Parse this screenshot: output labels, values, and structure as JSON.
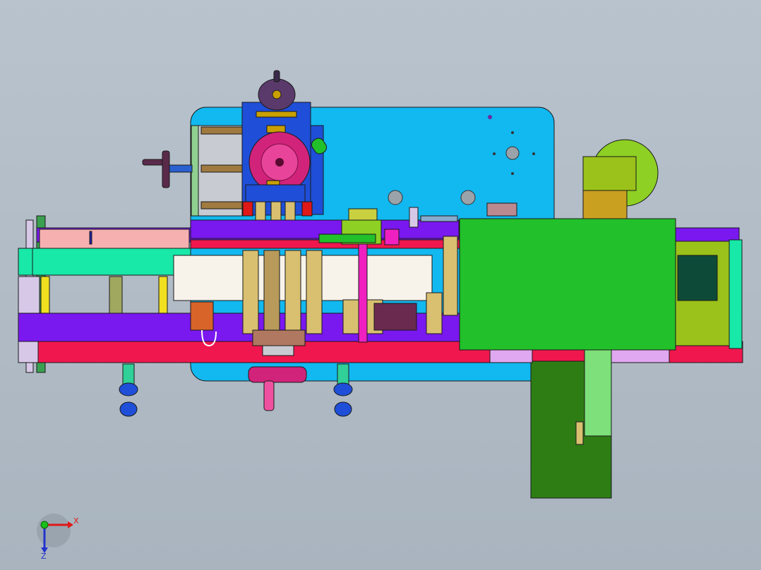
{
  "viewport": {
    "background_color": "#aeb8c2"
  },
  "triad": {
    "x_label": "X",
    "z_label": "Z",
    "x_color": "#e01818",
    "z_color": "#2233cc",
    "y_color": "#18c018"
  },
  "colors": {
    "cyan_plate": "#12b8f0",
    "blue_block": "#1f4fd8",
    "magenta_wheel": "#d2237a",
    "green_cover": "#22c02a",
    "red_rail": "#f0174e",
    "purple_rail": "#7a18f0",
    "dark_green_box": "#2e7d14",
    "olive_panel": "#9bc21a",
    "mint_bar": "#18e8a8",
    "tan_cylinder": "#d9c070"
  }
}
